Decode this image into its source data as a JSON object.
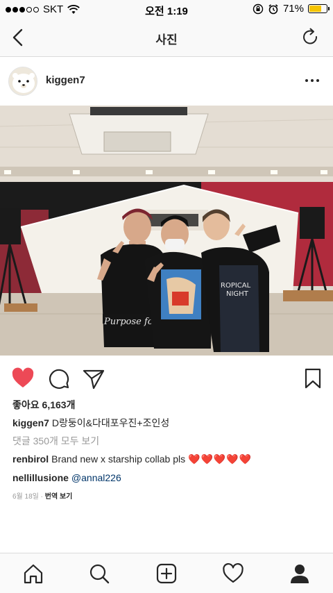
{
  "status_bar": {
    "carrier": "SKT",
    "time": "오전 1:19",
    "battery": "71%",
    "battery_level": 0.71,
    "battery_color": "#f5c400"
  },
  "nav": {
    "title": "사진",
    "back_icon": "chevron-left-icon",
    "refresh_icon": "refresh-icon"
  },
  "post": {
    "username": "kiggen7",
    "more_icon": "more-horizontal-icon",
    "liked": true,
    "like_color": "#ed4956",
    "likes_label": "좋아요 6,163개",
    "caption_user": "kiggen7",
    "caption_text": "D랑둥이&다대포우진+조인성",
    "view_all": "댓글 350개 모두 보기",
    "comments": [
      {
        "user": "renbirol",
        "text": "Brand new x starship collab pls",
        "hearts": "❤️❤️❤️❤️❤️"
      },
      {
        "user": "nellillusione",
        "mention": "@annal226"
      }
    ],
    "date": "6월 18일",
    "separator": "·",
    "translate": "번역 보기"
  },
  "tabbar": {
    "items": [
      "home-icon",
      "search-icon",
      "add-post-icon",
      "activity-heart-icon",
      "profile-icon"
    ]
  }
}
